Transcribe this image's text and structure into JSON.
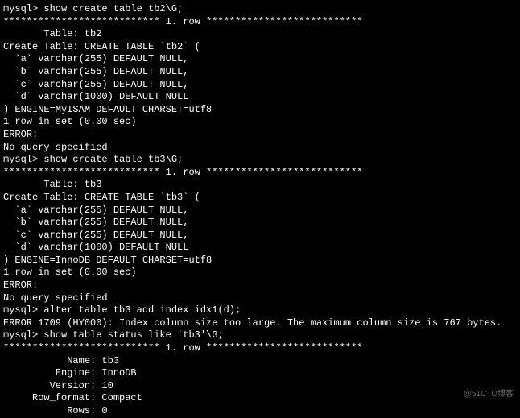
{
  "lines": [
    "mysql> show create table tb2\\G;",
    "*************************** 1. row ***************************",
    "       Table: tb2",
    "Create Table: CREATE TABLE `tb2` (",
    "  `a` varchar(255) DEFAULT NULL,",
    "  `b` varchar(255) DEFAULT NULL,",
    "  `c` varchar(255) DEFAULT NULL,",
    "  `d` varchar(1000) DEFAULT NULL",
    ") ENGINE=MyISAM DEFAULT CHARSET=utf8",
    "1 row in set (0.00 sec)",
    "",
    "ERROR: ",
    "No query specified",
    "",
    "mysql> show create table tb3\\G;",
    "*************************** 1. row ***************************",
    "       Table: tb3",
    "Create Table: CREATE TABLE `tb3` (",
    "  `a` varchar(255) DEFAULT NULL,",
    "  `b` varchar(255) DEFAULT NULL,",
    "  `c` varchar(255) DEFAULT NULL,",
    "  `d` varchar(1000) DEFAULT NULL",
    ") ENGINE=InnoDB DEFAULT CHARSET=utf8",
    "1 row in set (0.00 sec)",
    "",
    "ERROR: ",
    "No query specified",
    "",
    "mysql> alter table tb3 add index idx1(d);",
    "ERROR 1709 (HY000): Index column size too large. The maximum column size is 767 bytes.",
    "mysql> show table status like 'tb3'\\G;",
    "*************************** 1. row ***************************",
    "           Name: tb3",
    "         Engine: InnoDB",
    "        Version: 10",
    "     Row_format: Compact",
    "           Rows: 0"
  ],
  "watermark": "@51CTO博客"
}
